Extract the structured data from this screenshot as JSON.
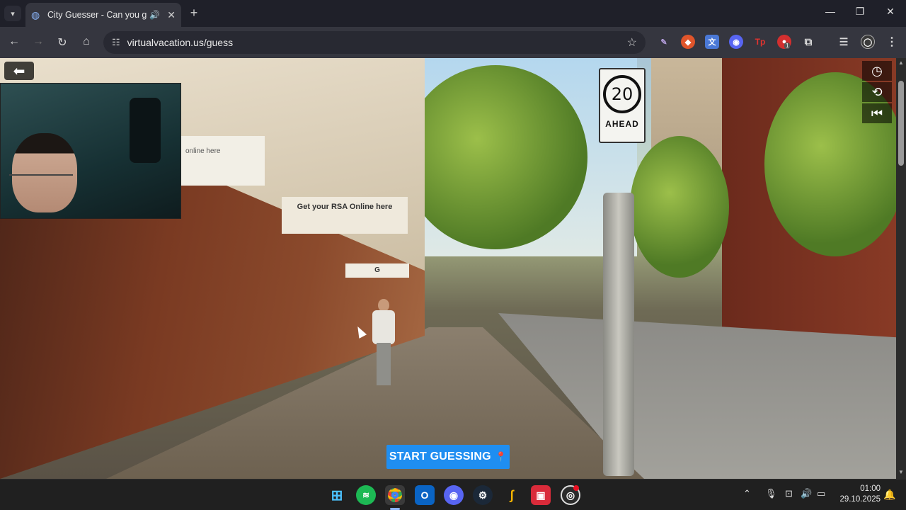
{
  "browser": {
    "tab_title": "City Guesser - Can you gue",
    "url": "virtualvacation.us/guess",
    "icons": {
      "tab_menu": "chevron-down-icon",
      "favicon": "globe-icon",
      "audio": "speaker-icon",
      "close_tab": "close-icon",
      "new_tab": "plus-icon",
      "back": "arrow-left-icon",
      "forward": "arrow-right-icon",
      "reload": "reload-icon",
      "home": "home-icon",
      "site_info": "tune-icon",
      "bookmark": "star-icon"
    },
    "window_controls": [
      "minimize",
      "maximize",
      "close"
    ],
    "extensions": [
      "pen-icon",
      "fox-icon",
      "translate-icon",
      "discord-icon",
      "tp-icon",
      "red-extension-icon",
      "puzzle-icon",
      "media-icon",
      "profile-icon",
      "more-icon"
    ],
    "extension_badge": "1"
  },
  "game": {
    "start_button_label": "START GUESSING",
    "speed_sign_number": "20",
    "speed_sign_text": "AHEAD",
    "shop_sign_text": "Get your RSA Online here",
    "shop_sign2_text": "G",
    "shop_sign3_text": "online here",
    "controls": [
      "back-arrow-icon",
      "clock-icon",
      "refresh-icon",
      "rewind-icon"
    ]
  },
  "taskbar": {
    "apps": [
      "windows-start-icon",
      "spotify-icon",
      "chrome-icon",
      "outlook-icon",
      "discord-icon",
      "steam-icon",
      "hotline-icon",
      "rush-icon",
      "obs-icon"
    ],
    "time": "01:00",
    "date": "29.10.2025"
  },
  "colors": {
    "accent": "#1f8ef1",
    "taskbar": "#202020",
    "toolbar": "#35363f"
  }
}
